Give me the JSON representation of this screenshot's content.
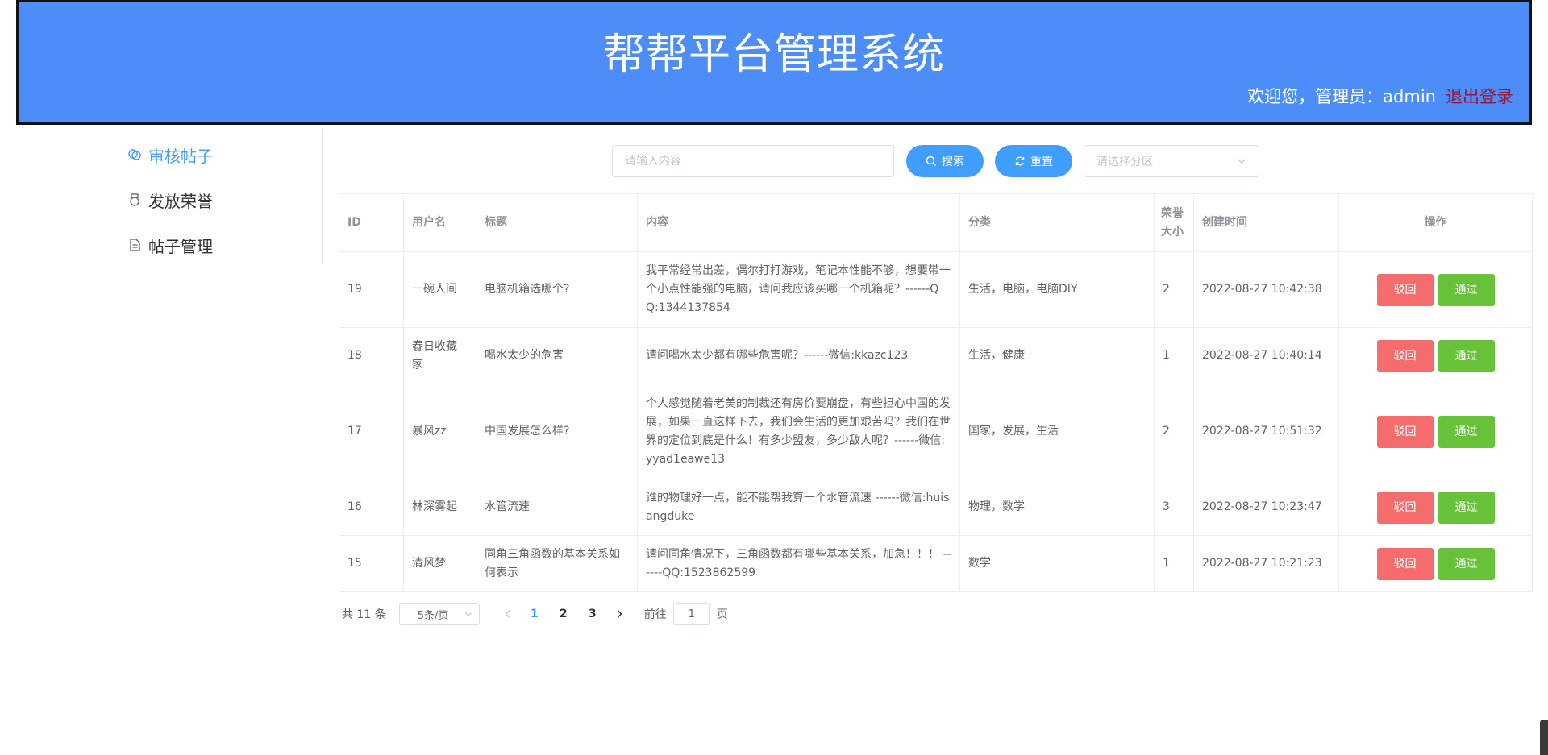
{
  "header": {
    "title": "帮帮平台管理系统",
    "welcome": "欢迎您，管理员：admin",
    "logout": "退出登录"
  },
  "sidebar": {
    "items": [
      {
        "label": "审核帖子",
        "icon": "review-icon",
        "active": true
      },
      {
        "label": "发放荣誉",
        "icon": "medal-icon",
        "active": false
      },
      {
        "label": "帖子管理",
        "icon": "document-icon",
        "active": false
      }
    ]
  },
  "toolbar": {
    "search_placeholder": "请输入内容",
    "search_label": "搜索",
    "reset_label": "重置",
    "select_placeholder": "请选择分区"
  },
  "table": {
    "headers": [
      "ID",
      "用户名",
      "标题",
      "内容",
      "分类",
      "荣誉大小",
      "创建时间",
      "操作"
    ],
    "reject_label": "驳回",
    "pass_label": "通过",
    "rows": [
      {
        "id": "19",
        "username": "一碗人间",
        "title": "电脑机箱选哪个?",
        "content": "我平常经常出差，偶尔打打游戏，笔记本性能不够，想要带一个小点性能强的电脑，请问我应该买哪一个机箱呢？------QQ:1344137854",
        "category": "生活，电脑，电脑DIY",
        "honor": "2",
        "created": "2022-08-27 10:42:38"
      },
      {
        "id": "18",
        "username": "春日收藏家",
        "title": "喝水太少的危害",
        "content": "请问喝水太少都有哪些危害呢？------微信:kkazc123",
        "category": "生活，健康",
        "honor": "1",
        "created": "2022-08-27 10:40:14"
      },
      {
        "id": "17",
        "username": "暴风zz",
        "title": "中国发展怎么样?",
        "content": "个人感觉随着老美的制裁还有房价要崩盘，有些担心中国的发展，如果一直这样下去，我们会生活的更加艰苦吗？我们在世界的定位到底是什么！有多少盟友，多少敌人呢？------微信:yyad1eawe13",
        "category": "国家，发展，生活",
        "honor": "2",
        "created": "2022-08-27 10:51:32"
      },
      {
        "id": "16",
        "username": "林深雾起",
        "title": "水管流速",
        "content": "谁的物理好一点，能不能帮我算一个水管流速 ------微信:huisangduke",
        "category": "物理，数学",
        "honor": "3",
        "created": "2022-08-27 10:23:47"
      },
      {
        "id": "15",
        "username": "清风梦",
        "title": "同角三角函数的基本关系如何表示",
        "content": "请问同角情况下，三角函数都有哪些基本关系，加急！！！ ------QQ:1523862599",
        "category": "数学",
        "honor": "1",
        "created": "2022-08-27 10:21:23"
      }
    ]
  },
  "pagination": {
    "total": "共 11 条",
    "page_size": "5条/页",
    "pages": [
      "1",
      "2",
      "3"
    ],
    "current_page": "1",
    "goto_prefix": "前往",
    "goto_value": "1",
    "goto_suffix": "页"
  }
}
